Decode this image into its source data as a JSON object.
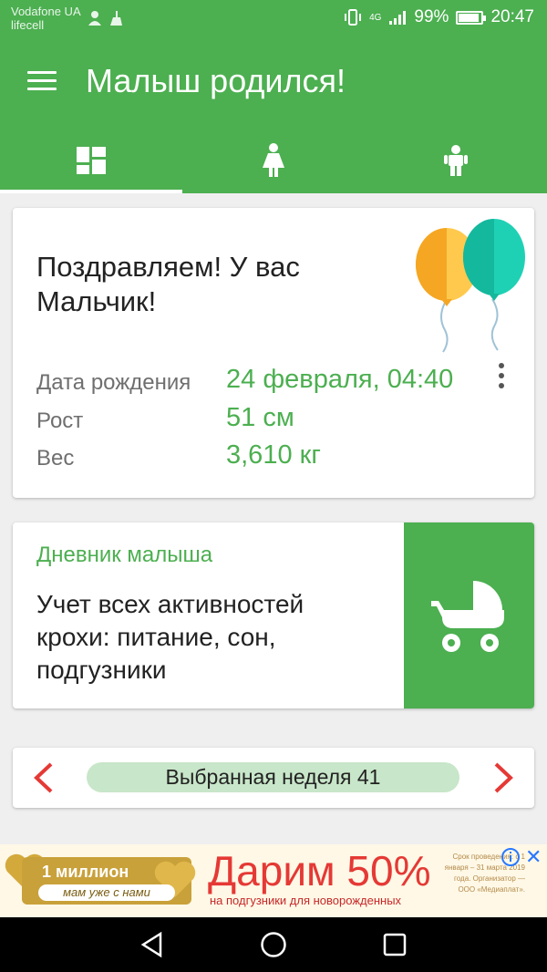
{
  "status_bar": {
    "carrier_line1": "Vodafone UA",
    "carrier_line2": "lifecell",
    "network": "4G",
    "battery": "99%",
    "time": "20:47"
  },
  "app_bar": {
    "title": "Малыш родился!",
    "color": "#4caf50",
    "tabs": [
      {
        "icon": "dashboard-icon",
        "active": true
      },
      {
        "icon": "girl-icon",
        "active": false
      },
      {
        "icon": "boy-icon",
        "active": false
      }
    ]
  },
  "birth_card": {
    "congrats": "Поздравляем! У вас Мальчик!",
    "rows": [
      {
        "label": "Дата рождения",
        "value": "24 февраля, 04:40"
      },
      {
        "label": "Рост",
        "value": "51 см"
      },
      {
        "label": "Вес",
        "value": "3,610 кг"
      }
    ]
  },
  "diary_card": {
    "title": "Дневник малыша",
    "text": "Учет всех активностей крохи: питание, сон, подгузники",
    "icon": "stroller-icon"
  },
  "week_selector": {
    "label": "Выбранная неделя 41",
    "arrow_color": "#e53935"
  },
  "ad": {
    "million": "1 миллион",
    "moms": "мам уже с нами",
    "headline": "Дарим 50%",
    "sub": "на подгузники для новорожденных",
    "fine_print": "Срок проведения: с 1 января – 31 марта 2019 года. Организатор — ООО «Медиаплат»."
  },
  "nav_bar": {
    "buttons": [
      "back-icon",
      "home-icon",
      "recents-icon"
    ]
  }
}
